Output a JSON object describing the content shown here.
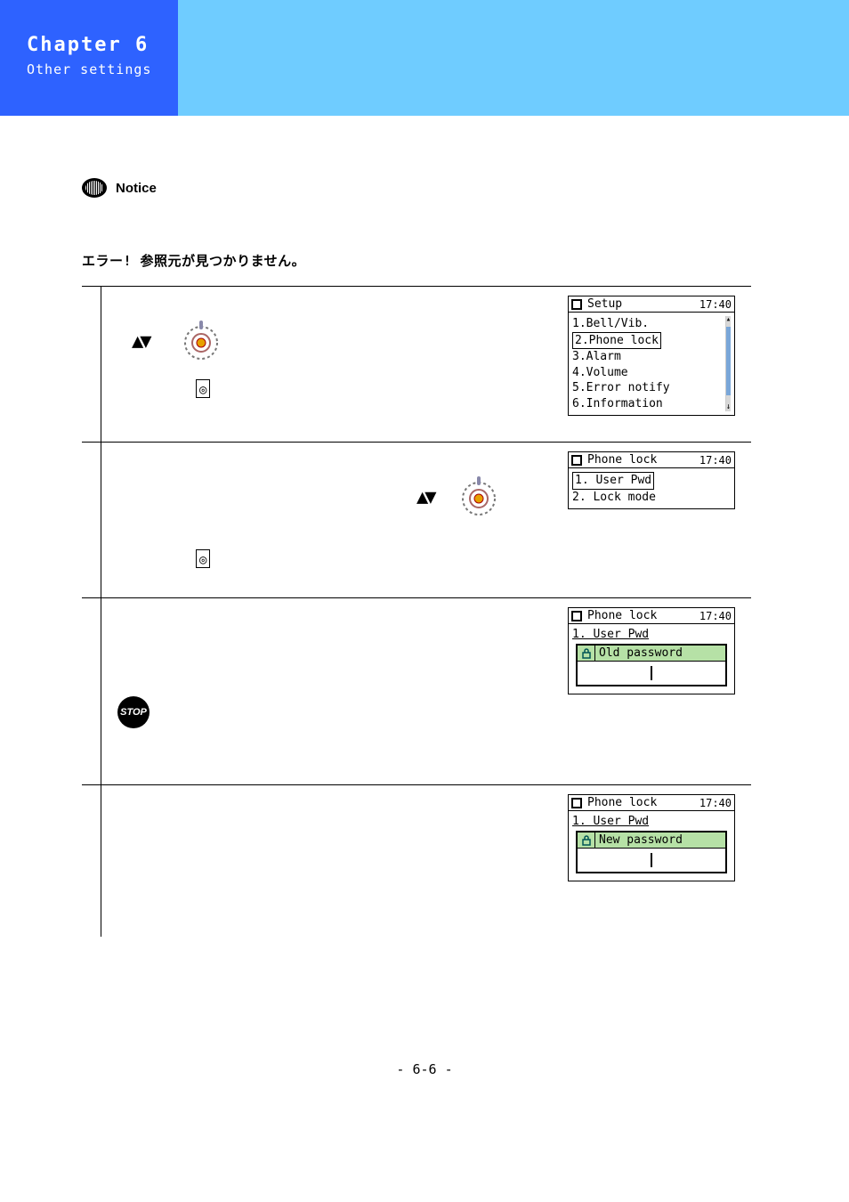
{
  "header": {
    "chapter": "Chapter 6",
    "subtitle": "Other settings"
  },
  "notice": {
    "label": "Notice"
  },
  "error_line": "エラー! 参照元が見つかりません。",
  "glyphs": {
    "updown": "▲▼",
    "target": "◎",
    "stop": "STOP"
  },
  "screens": {
    "setup": {
      "title": "Setup",
      "time": "17:40",
      "items": [
        "1.Bell/Vib.",
        "2.Phone lock",
        "3.Alarm",
        "4.Volume",
        "5.Error notify",
        "6.Information"
      ],
      "selected_index": 1
    },
    "phonelock_menu": {
      "title": "Phone lock",
      "time": "17:40",
      "items": [
        "1. User Pwd",
        "2. Lock mode"
      ],
      "selected_index": 0
    },
    "phonelock_old": {
      "title": "Phone lock",
      "time": "17:40",
      "crumb": "1. User Pwd",
      "field_label": "Old password"
    },
    "phonelock_new": {
      "title": "Phone lock",
      "time": "17:40",
      "crumb": "1. User Pwd",
      "field_label": "New password"
    }
  },
  "footer": "- 6-6 -"
}
